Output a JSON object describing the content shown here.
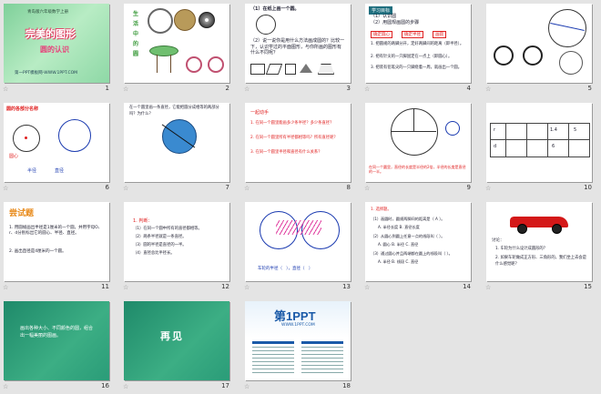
{
  "slides": [
    {
      "num": "1",
      "kicker": "青岛版六年级数学上册",
      "title": "完美的图形",
      "subtitle": "圆的认识",
      "footer": "第一PPT模板网-WWW.1PPT.COM"
    },
    {
      "num": "2",
      "caption": "生活中的圆"
    },
    {
      "num": "3",
      "line1": "（1）在纸上画一个圆。",
      "line2": "（2）说一说你是用什么方法画成圆的？比较一下，认识学过的平面图形，与你所画的图形有什么不同呢？"
    },
    {
      "num": "4",
      "head": "学习目标",
      "items": [
        "（1）认识圆",
        "（2）用圆规画圆的步骤"
      ],
      "tabs": [
        "确定圆心",
        "确定半径",
        "画圆"
      ],
      "steps": [
        "1. 把圆规的两脚分开，定好两脚间的距离（即半径）。",
        "2. 把有针尖的一只脚固定在一点上（即圆心）。",
        "3. 把装有铅笔尖的一只脚绕着一周，就画出一个圆。"
      ]
    },
    {
      "num": "5"
    },
    {
      "num": "6",
      "head": "圆的各部分名称",
      "labels": [
        "圆心",
        "半径",
        "直径"
      ]
    },
    {
      "num": "7",
      "line1": "在一个圆里画一条直径，它能把圆分成相等的两部分吗？为什么？"
    },
    {
      "num": "8",
      "head": "一起动手",
      "items": [
        "1. 在同一个圆里能画多少条半径？多少条直径？",
        "2. 在同一个圆里所有半径都相等吗？所有直径呢？",
        "3. 在同一个圆里半径和直径有什么关系？"
      ]
    },
    {
      "num": "9",
      "note": "在同一个圆里，直径的长度是半径的2倍，半径的长度是直径的一半。"
    },
    {
      "num": "10",
      "rowlabels": [
        "r",
        "d"
      ],
      "cells": [
        "1.4",
        "5",
        "6"
      ]
    },
    {
      "num": "11",
      "head": "尝试题",
      "items": [
        "1. 用圆规画出半径是1厘米的一个圆，并用字母O、r、d分别标出它的圆心、半径、直径。",
        "2. 画出直径是4厘米的一个圆。"
      ]
    },
    {
      "num": "12",
      "items": [
        "1. 判断：",
        "（1）在同一个圆中所有的直径都相等。",
        "（2）两条半径就是一条直径。",
        "（3）圆的半径是直径的一半。",
        "（4）直径总比半径长。"
      ]
    },
    {
      "num": "13",
      "caption_a": "车轮的半径（",
      "caption_b": "），直径（",
      "caption_c": "）"
    },
    {
      "num": "14",
      "items": [
        "1. 选择题。",
        "（1）画圆时，圆规两脚间的距离是（ A ）。",
        "A. 半径长度  B. 直径长度",
        "（2）从圆心到圆上任意一点的线段叫（ ）。",
        "A. 圆心  B. 半径  C. 直径",
        "（3）通过圆心并且两端都在圆上的线段叫（ ）。",
        "A. 半径  B. 线段  C. 直径"
      ]
    },
    {
      "num": "15",
      "head": "讨论：",
      "items": [
        "1. 车轮为什么设计成圆形的？",
        "2. 如果车轮做成正方形、三角形的，我们坐上去会是什么感觉呢？"
      ]
    },
    {
      "num": "16",
      "text": "画出各种大小、不同颜色的圆，组合出一幅美丽的图画。"
    },
    {
      "num": "17",
      "text": "再见"
    },
    {
      "num": "18",
      "brand": "第1PPT",
      "tagline": "WWW.1PPT.COM"
    }
  ]
}
